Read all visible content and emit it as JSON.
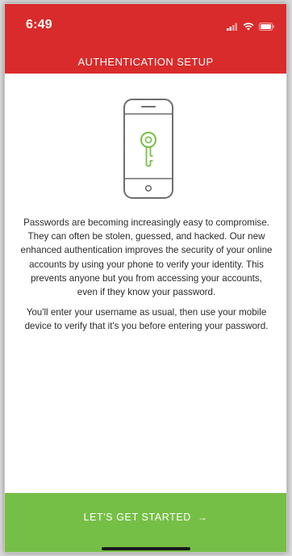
{
  "status_bar": {
    "time": "6:49"
  },
  "header": {
    "title": "AUTHENTICATION SETUP"
  },
  "illustration": {
    "icon": "phone-with-key-icon"
  },
  "body": {
    "paragraphs": [
      "Passwords are becoming increasingly easy to compromise. They can often be stolen, guessed, and hacked. Our new enhanced authentication improves the security of your online accounts by using your phone to verify your identity. This prevents anyone but you from accessing your accounts, even if they know your password.",
      "You'll enter your username as usual, then use your mobile device to verify that it's you before entering your password."
    ]
  },
  "cta": {
    "label": "LET'S GET STARTED",
    "arrow": "→"
  },
  "colors": {
    "header_red": "#d92b2b",
    "cta_green": "#76bf46",
    "key_green": "#76bf46"
  }
}
